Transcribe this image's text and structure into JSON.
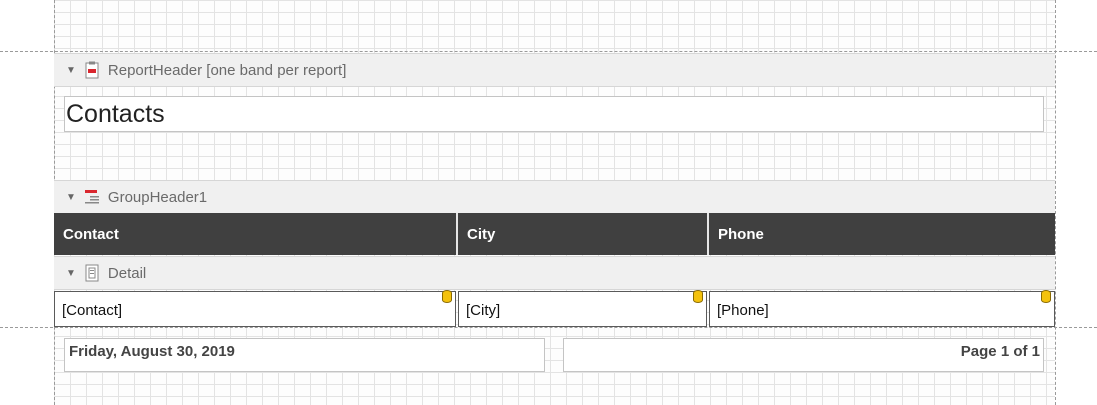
{
  "report_header": {
    "label": "ReportHeader [one band per report]",
    "icon": "report-header-icon"
  },
  "title": "Contacts",
  "group_header": {
    "label": "GroupHeader1",
    "icon": "group-header-icon"
  },
  "columns": [
    "Contact",
    "City",
    "Phone"
  ],
  "detail": {
    "label": "Detail",
    "icon": "detail-icon"
  },
  "fields": [
    "[Contact]",
    "[City]",
    "[Phone]"
  ],
  "footer": {
    "date": "Friday, August 30, 2019",
    "page": "Page 1 of 1"
  },
  "colors": {
    "header_bg": "#404040",
    "band_bg": "#f0f0f0",
    "db_icon": "#f4c20d",
    "icon_red": "#d9262e"
  }
}
